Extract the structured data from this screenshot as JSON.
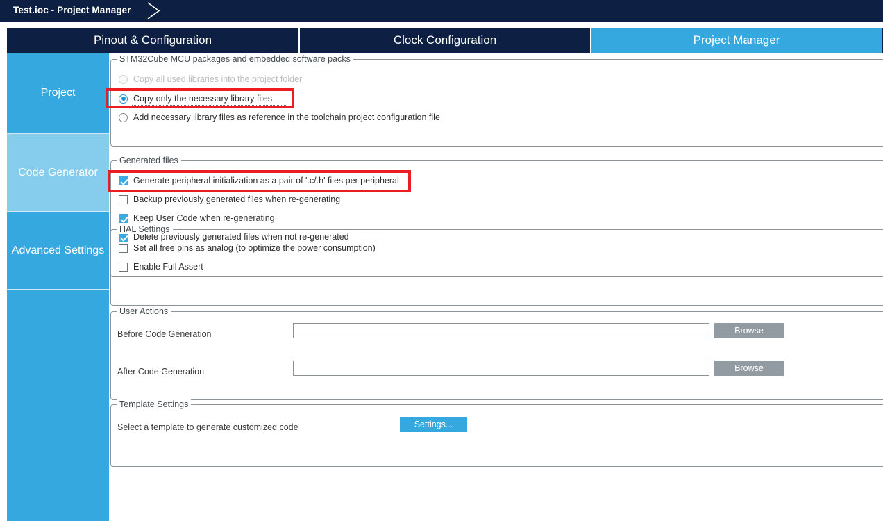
{
  "window": {
    "title": "Test.ioc - Project Manager",
    "chevron_icon": "chevron-right-icon"
  },
  "tabs": [
    {
      "label": "Pinout & Configuration",
      "active": false
    },
    {
      "label": "Clock Configuration",
      "active": false
    },
    {
      "label": "Project Manager",
      "active": true
    }
  ],
  "sidebar": {
    "items": [
      {
        "label": "Project",
        "selected": false
      },
      {
        "label": "Code Generator",
        "selected": true
      },
      {
        "label": "Advanced Settings",
        "selected": false
      },
      {
        "label": "",
        "selected": false
      }
    ]
  },
  "groups": {
    "packages": {
      "legend": "STM32Cube MCU packages and embedded software packs",
      "options": [
        {
          "label": "Copy all used libraries into the project folder",
          "checked": false,
          "disabled": true
        },
        {
          "label": "Copy only the necessary library files",
          "checked": true,
          "disabled": false
        },
        {
          "label": "Add necessary library files as reference in the toolchain project configuration file",
          "checked": false,
          "disabled": false
        }
      ]
    },
    "generated_files": {
      "legend": "Generated files",
      "options": [
        {
          "label": "Generate peripheral initialization as a pair of '.c/.h' files per peripheral",
          "checked": true
        },
        {
          "label": "Backup previously generated files when re-generating",
          "checked": false
        },
        {
          "label": "Keep User Code when re-generating",
          "checked": true
        },
        {
          "label": "Delete previously generated files when not re-generated",
          "checked": true
        }
      ]
    },
    "hal_settings": {
      "legend": "HAL Settings",
      "options": [
        {
          "label": "Set all free pins as analog (to optimize the power consumption)",
          "checked": false
        },
        {
          "label": "Enable Full Assert",
          "checked": false
        }
      ]
    },
    "user_actions": {
      "legend": "User Actions",
      "rows": [
        {
          "label": "Before Code Generation",
          "value": "",
          "placeholder": "",
          "button": "Browse"
        },
        {
          "label": "After Code Generation",
          "value": "",
          "placeholder": "",
          "button": "Browse"
        }
      ]
    },
    "template_settings": {
      "legend": "Template Settings",
      "label": "Select a template to generate customized code",
      "button": "Settings..."
    }
  },
  "colors": {
    "titlebar": "#0d2043",
    "tab_inactive": "#0d2043",
    "tab_active": "#35a8e0",
    "sidebar": "#35a8e0",
    "sidebar_selected": "#86ccec",
    "highlight": "#ec1c24",
    "checkbox_checked": "#3cabe2",
    "radio_checked": "#2196c9",
    "browse_button": "#939ba2",
    "settings_button": "#35a8e0"
  }
}
